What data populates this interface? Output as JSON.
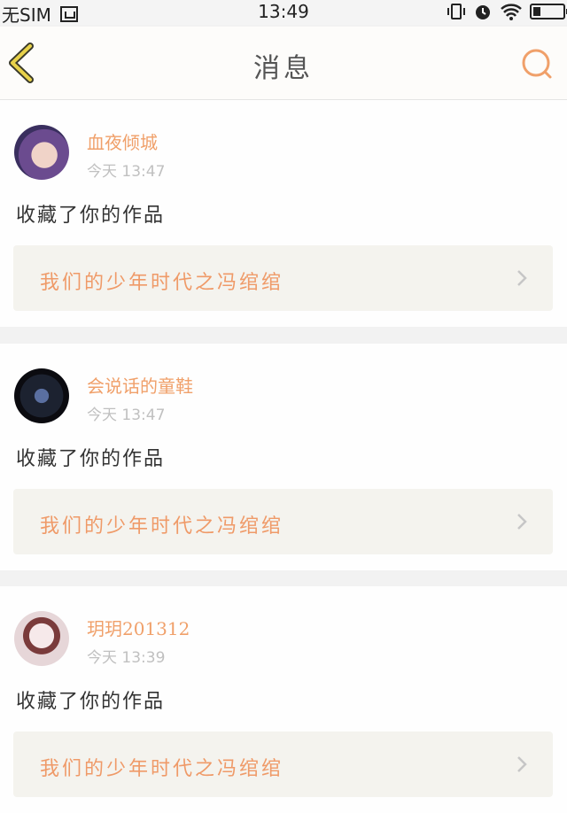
{
  "status_bar": {
    "carrier": "无SIM",
    "time": "13:49"
  },
  "header": {
    "title": "消息",
    "back_icon": "chevron-left-icon",
    "search_icon": "search-icon"
  },
  "colors": {
    "accent": "#f0a06a",
    "back_icon": "#e8d24a",
    "background": "#f2f2f2"
  },
  "messages": [
    {
      "username": "血夜倾城",
      "time": "今天 13:47",
      "action": "收藏了你的作品",
      "work_title": "我们的少年时代之冯绾绾"
    },
    {
      "username": "会说话的童鞋",
      "time": "今天 13:47",
      "action": "收藏了你的作品",
      "work_title": "我们的少年时代之冯绾绾"
    },
    {
      "username": "玥玥201312",
      "time": "今天 13:39",
      "action": "收藏了你的作品",
      "work_title": "我们的少年时代之冯绾绾"
    }
  ]
}
